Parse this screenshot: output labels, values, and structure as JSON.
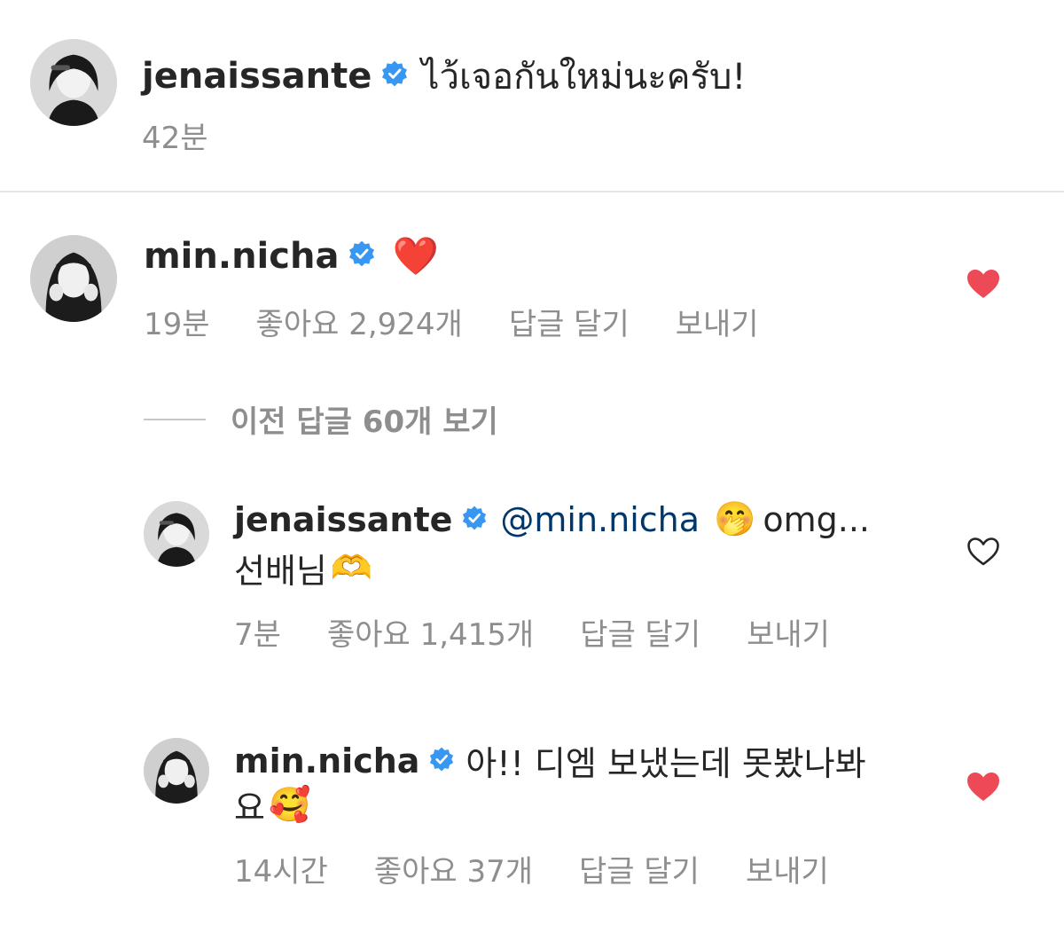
{
  "caption": {
    "username": "jenaissante",
    "text": "ไว้เจอกันใหม่นะครับ!",
    "time": "42분"
  },
  "comment1": {
    "username": "min.nicha",
    "emoji": "❤️",
    "time": "19분",
    "likes": "좋아요 2,924개",
    "reply": "답글 달기",
    "send": "보내기"
  },
  "view_replies": "이전 답글 60개 보기",
  "reply1": {
    "username": "jenaissante",
    "mention": "@min.nicha",
    "emoji": "🤭",
    "text_a": "omg...",
    "text_b": "선배님",
    "emoji_b": "🫶",
    "time": "7분",
    "likes": "좋아요 1,415개",
    "reply": "답글 달기",
    "send": "보내기"
  },
  "reply2": {
    "username": "min.nicha",
    "text_a": "아!! 디엠 보냈는데 못봤나봐",
    "text_b": "요",
    "emoji_b": "🥰",
    "time": "14시간",
    "likes": "좋아요 37개",
    "reply": "답글 달기",
    "send": "보내기"
  },
  "colors": {
    "verified": "#3897f0",
    "heart_liked": "#ed4956",
    "meta": "#8e8e8e",
    "mention": "#00376b"
  },
  "icons": {
    "verified": "verified-badge-icon",
    "liked": "heart-filled-icon",
    "unliked": "heart-outline-icon"
  }
}
